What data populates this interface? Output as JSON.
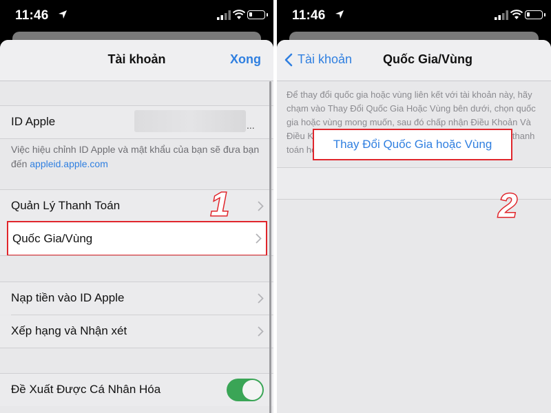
{
  "status": {
    "time": "11:46"
  },
  "left": {
    "title": "Tài khoản",
    "done_label": "Xong",
    "apple_id_label": "ID Apple",
    "apple_id_masked": "...",
    "footnote_text": "Việc hiệu chỉnh ID Apple và mật khẩu của bạn sẽ đưa bạn đến ",
    "footnote_link": "appleid.apple.com",
    "rows": [
      "Quản Lý Thanh Toán",
      "Quốc Gia/Vùng",
      "Nạp tiền vào ID Apple",
      "Xếp hạng và Nhận xét"
    ],
    "personalized_label": "Đề Xuất Được Cá Nhân Hóa",
    "personalized_on": true,
    "step": "1"
  },
  "right": {
    "back_label": "Tài khoản",
    "title": "Quốc Gia/Vùng",
    "description": "Để thay đổi quốc gia hoặc vùng liên kết với tài khoản này, hãy chạm vào Thay Đổi Quốc Gia Hoặc Vùng bên dưới, chọn quốc gia hoặc vùng mong muốn, sau đó chấp nhận Điều Khoản Và Điều Kiện mới. Lưu ý rằng bạn cần có một phương thức thanh toán hợp lệ cho quốc gia hoặc vùng mới.",
    "action_label": "Thay Đổi Quốc Gia hoặc Vùng",
    "step": "2"
  },
  "colors": {
    "accent": "#2f7fe0",
    "highlight": "#e0252b",
    "toggle_on": "#3aa556"
  }
}
